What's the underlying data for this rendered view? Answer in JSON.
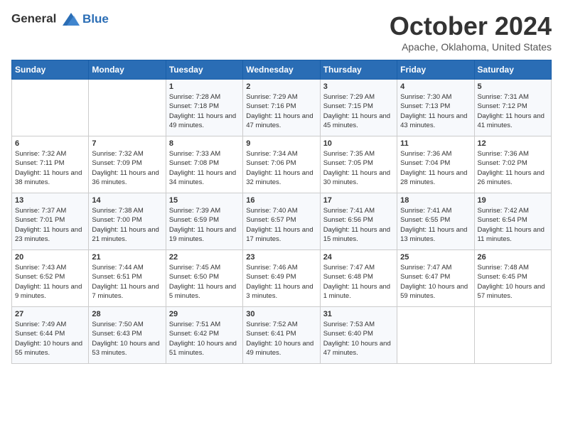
{
  "logo": {
    "line1": "General",
    "line2": "Blue"
  },
  "title": "October 2024",
  "subtitle": "Apache, Oklahoma, United States",
  "days_of_week": [
    "Sunday",
    "Monday",
    "Tuesday",
    "Wednesday",
    "Thursday",
    "Friday",
    "Saturday"
  ],
  "weeks": [
    [
      {
        "num": "",
        "info": ""
      },
      {
        "num": "",
        "info": ""
      },
      {
        "num": "1",
        "info": "Sunrise: 7:28 AM\nSunset: 7:18 PM\nDaylight: 11 hours and 49 minutes."
      },
      {
        "num": "2",
        "info": "Sunrise: 7:29 AM\nSunset: 7:16 PM\nDaylight: 11 hours and 47 minutes."
      },
      {
        "num": "3",
        "info": "Sunrise: 7:29 AM\nSunset: 7:15 PM\nDaylight: 11 hours and 45 minutes."
      },
      {
        "num": "4",
        "info": "Sunrise: 7:30 AM\nSunset: 7:13 PM\nDaylight: 11 hours and 43 minutes."
      },
      {
        "num": "5",
        "info": "Sunrise: 7:31 AM\nSunset: 7:12 PM\nDaylight: 11 hours and 41 minutes."
      }
    ],
    [
      {
        "num": "6",
        "info": "Sunrise: 7:32 AM\nSunset: 7:11 PM\nDaylight: 11 hours and 38 minutes."
      },
      {
        "num": "7",
        "info": "Sunrise: 7:32 AM\nSunset: 7:09 PM\nDaylight: 11 hours and 36 minutes."
      },
      {
        "num": "8",
        "info": "Sunrise: 7:33 AM\nSunset: 7:08 PM\nDaylight: 11 hours and 34 minutes."
      },
      {
        "num": "9",
        "info": "Sunrise: 7:34 AM\nSunset: 7:06 PM\nDaylight: 11 hours and 32 minutes."
      },
      {
        "num": "10",
        "info": "Sunrise: 7:35 AM\nSunset: 7:05 PM\nDaylight: 11 hours and 30 minutes."
      },
      {
        "num": "11",
        "info": "Sunrise: 7:36 AM\nSunset: 7:04 PM\nDaylight: 11 hours and 28 minutes."
      },
      {
        "num": "12",
        "info": "Sunrise: 7:36 AM\nSunset: 7:02 PM\nDaylight: 11 hours and 26 minutes."
      }
    ],
    [
      {
        "num": "13",
        "info": "Sunrise: 7:37 AM\nSunset: 7:01 PM\nDaylight: 11 hours and 23 minutes."
      },
      {
        "num": "14",
        "info": "Sunrise: 7:38 AM\nSunset: 7:00 PM\nDaylight: 11 hours and 21 minutes."
      },
      {
        "num": "15",
        "info": "Sunrise: 7:39 AM\nSunset: 6:59 PM\nDaylight: 11 hours and 19 minutes."
      },
      {
        "num": "16",
        "info": "Sunrise: 7:40 AM\nSunset: 6:57 PM\nDaylight: 11 hours and 17 minutes."
      },
      {
        "num": "17",
        "info": "Sunrise: 7:41 AM\nSunset: 6:56 PM\nDaylight: 11 hours and 15 minutes."
      },
      {
        "num": "18",
        "info": "Sunrise: 7:41 AM\nSunset: 6:55 PM\nDaylight: 11 hours and 13 minutes."
      },
      {
        "num": "19",
        "info": "Sunrise: 7:42 AM\nSunset: 6:54 PM\nDaylight: 11 hours and 11 minutes."
      }
    ],
    [
      {
        "num": "20",
        "info": "Sunrise: 7:43 AM\nSunset: 6:52 PM\nDaylight: 11 hours and 9 minutes."
      },
      {
        "num": "21",
        "info": "Sunrise: 7:44 AM\nSunset: 6:51 PM\nDaylight: 11 hours and 7 minutes."
      },
      {
        "num": "22",
        "info": "Sunrise: 7:45 AM\nSunset: 6:50 PM\nDaylight: 11 hours and 5 minutes."
      },
      {
        "num": "23",
        "info": "Sunrise: 7:46 AM\nSunset: 6:49 PM\nDaylight: 11 hours and 3 minutes."
      },
      {
        "num": "24",
        "info": "Sunrise: 7:47 AM\nSunset: 6:48 PM\nDaylight: 11 hours and 1 minute."
      },
      {
        "num": "25",
        "info": "Sunrise: 7:47 AM\nSunset: 6:47 PM\nDaylight: 10 hours and 59 minutes."
      },
      {
        "num": "26",
        "info": "Sunrise: 7:48 AM\nSunset: 6:45 PM\nDaylight: 10 hours and 57 minutes."
      }
    ],
    [
      {
        "num": "27",
        "info": "Sunrise: 7:49 AM\nSunset: 6:44 PM\nDaylight: 10 hours and 55 minutes."
      },
      {
        "num": "28",
        "info": "Sunrise: 7:50 AM\nSunset: 6:43 PM\nDaylight: 10 hours and 53 minutes."
      },
      {
        "num": "29",
        "info": "Sunrise: 7:51 AM\nSunset: 6:42 PM\nDaylight: 10 hours and 51 minutes."
      },
      {
        "num": "30",
        "info": "Sunrise: 7:52 AM\nSunset: 6:41 PM\nDaylight: 10 hours and 49 minutes."
      },
      {
        "num": "31",
        "info": "Sunrise: 7:53 AM\nSunset: 6:40 PM\nDaylight: 10 hours and 47 minutes."
      },
      {
        "num": "",
        "info": ""
      },
      {
        "num": "",
        "info": ""
      }
    ]
  ]
}
